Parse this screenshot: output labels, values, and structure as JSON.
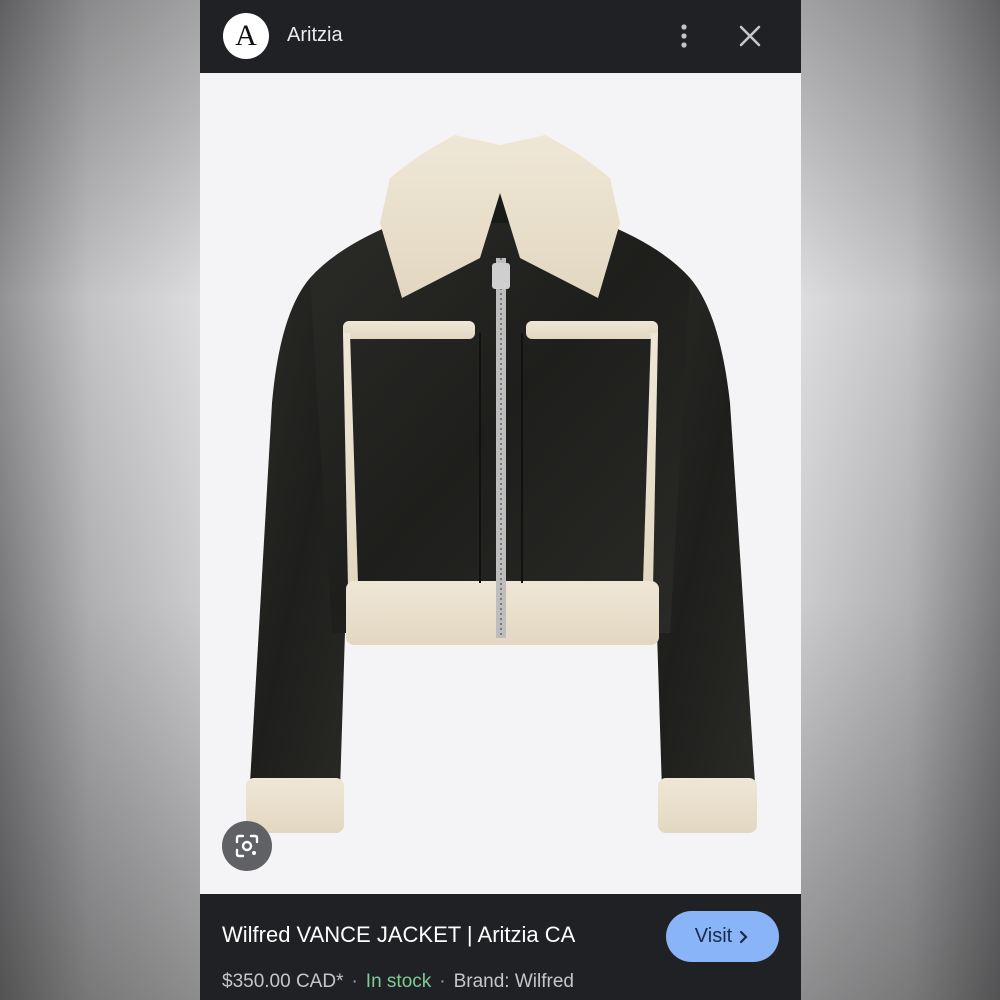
{
  "header": {
    "logo_letter": "A",
    "site_name": "Aritzia",
    "icons": [
      "more-vert-icon",
      "close-icon"
    ]
  },
  "image": {
    "subject": "black faux leather jacket with cream shearling trim",
    "lens_icon": "google-lens-icon"
  },
  "product": {
    "title": "Wilfred VANCE JACKET | Aritzia CA",
    "visit_label": "Visit",
    "price": "$350.00 CAD*",
    "separator": "·",
    "stock": "In stock",
    "brand": "Brand: Wilfred"
  },
  "colors": {
    "topbar": "#202124",
    "accent": "#8ab4f8",
    "in_stock": "#81c995"
  }
}
